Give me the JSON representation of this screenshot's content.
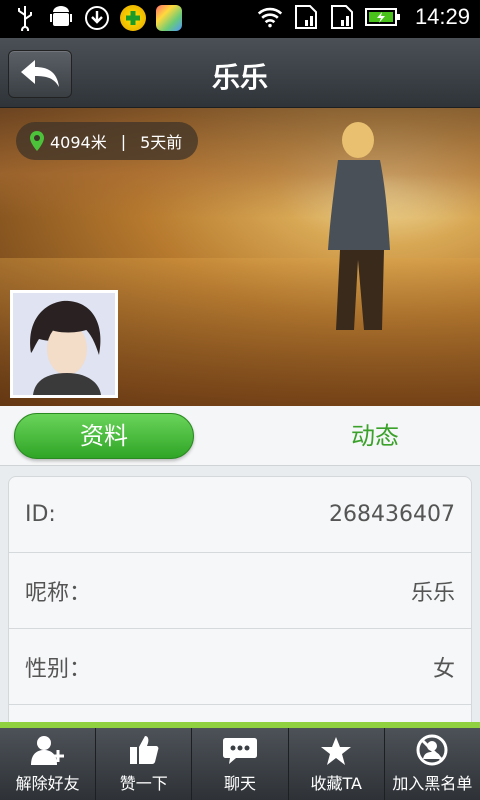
{
  "status_bar": {
    "time": "14:29",
    "icons": [
      "usb-icon",
      "android-debug-icon",
      "download-icon",
      "app-plus-icon",
      "app-store-icon",
      "wifi-icon",
      "sim1-icon",
      "sim2-icon",
      "battery-icon"
    ]
  },
  "header": {
    "title": "乐乐",
    "back_icon": "back-arrow-icon"
  },
  "profile": {
    "distance": "4094米",
    "separator": "|",
    "last_seen": "5天前"
  },
  "tabs": [
    {
      "label": "资料",
      "active": true
    },
    {
      "label": "动态",
      "active": false
    }
  ],
  "info_rows": [
    {
      "label": "ID:",
      "value": "268436407"
    },
    {
      "label": "呢称：",
      "value": "乐乐"
    },
    {
      "label": "性别：",
      "value": "女"
    }
  ],
  "toolbar": {
    "items": [
      {
        "label": "解除好友",
        "icon": "remove-friend-icon"
      },
      {
        "label": "赞一下",
        "icon": "thumbs-up-icon"
      },
      {
        "label": "聊天",
        "icon": "chat-icon"
      },
      {
        "label": "收藏TA",
        "icon": "star-icon"
      },
      {
        "label": "加入黑名单",
        "icon": "block-user-icon"
      }
    ]
  },
  "colors": {
    "accent_green": "#3aa12a",
    "bar_dark": "#2f3439",
    "toolbar_green_line": "#8fd13f"
  }
}
